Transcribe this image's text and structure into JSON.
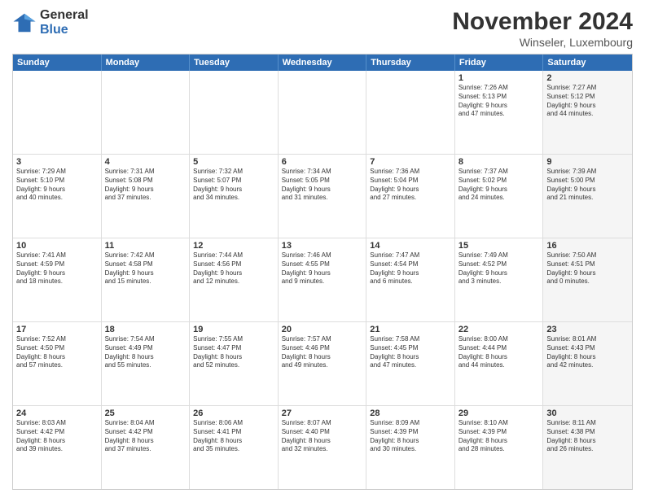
{
  "header": {
    "logo_line1": "General",
    "logo_line2": "Blue",
    "month": "November 2024",
    "location": "Winseler, Luxembourg"
  },
  "days_of_week": [
    "Sunday",
    "Monday",
    "Tuesday",
    "Wednesday",
    "Thursday",
    "Friday",
    "Saturday"
  ],
  "rows": [
    [
      {
        "day": "",
        "info": "",
        "shaded": false
      },
      {
        "day": "",
        "info": "",
        "shaded": false
      },
      {
        "day": "",
        "info": "",
        "shaded": false
      },
      {
        "day": "",
        "info": "",
        "shaded": false
      },
      {
        "day": "",
        "info": "",
        "shaded": false
      },
      {
        "day": "1",
        "info": "Sunrise: 7:26 AM\nSunset: 5:13 PM\nDaylight: 9 hours\nand 47 minutes.",
        "shaded": false
      },
      {
        "day": "2",
        "info": "Sunrise: 7:27 AM\nSunset: 5:12 PM\nDaylight: 9 hours\nand 44 minutes.",
        "shaded": true
      }
    ],
    [
      {
        "day": "3",
        "info": "Sunrise: 7:29 AM\nSunset: 5:10 PM\nDaylight: 9 hours\nand 40 minutes.",
        "shaded": false
      },
      {
        "day": "4",
        "info": "Sunrise: 7:31 AM\nSunset: 5:08 PM\nDaylight: 9 hours\nand 37 minutes.",
        "shaded": false
      },
      {
        "day": "5",
        "info": "Sunrise: 7:32 AM\nSunset: 5:07 PM\nDaylight: 9 hours\nand 34 minutes.",
        "shaded": false
      },
      {
        "day": "6",
        "info": "Sunrise: 7:34 AM\nSunset: 5:05 PM\nDaylight: 9 hours\nand 31 minutes.",
        "shaded": false
      },
      {
        "day": "7",
        "info": "Sunrise: 7:36 AM\nSunset: 5:04 PM\nDaylight: 9 hours\nand 27 minutes.",
        "shaded": false
      },
      {
        "day": "8",
        "info": "Sunrise: 7:37 AM\nSunset: 5:02 PM\nDaylight: 9 hours\nand 24 minutes.",
        "shaded": false
      },
      {
        "day": "9",
        "info": "Sunrise: 7:39 AM\nSunset: 5:00 PM\nDaylight: 9 hours\nand 21 minutes.",
        "shaded": true
      }
    ],
    [
      {
        "day": "10",
        "info": "Sunrise: 7:41 AM\nSunset: 4:59 PM\nDaylight: 9 hours\nand 18 minutes.",
        "shaded": false
      },
      {
        "day": "11",
        "info": "Sunrise: 7:42 AM\nSunset: 4:58 PM\nDaylight: 9 hours\nand 15 minutes.",
        "shaded": false
      },
      {
        "day": "12",
        "info": "Sunrise: 7:44 AM\nSunset: 4:56 PM\nDaylight: 9 hours\nand 12 minutes.",
        "shaded": false
      },
      {
        "day": "13",
        "info": "Sunrise: 7:46 AM\nSunset: 4:55 PM\nDaylight: 9 hours\nand 9 minutes.",
        "shaded": false
      },
      {
        "day": "14",
        "info": "Sunrise: 7:47 AM\nSunset: 4:54 PM\nDaylight: 9 hours\nand 6 minutes.",
        "shaded": false
      },
      {
        "day": "15",
        "info": "Sunrise: 7:49 AM\nSunset: 4:52 PM\nDaylight: 9 hours\nand 3 minutes.",
        "shaded": false
      },
      {
        "day": "16",
        "info": "Sunrise: 7:50 AM\nSunset: 4:51 PM\nDaylight: 9 hours\nand 0 minutes.",
        "shaded": true
      }
    ],
    [
      {
        "day": "17",
        "info": "Sunrise: 7:52 AM\nSunset: 4:50 PM\nDaylight: 8 hours\nand 57 minutes.",
        "shaded": false
      },
      {
        "day": "18",
        "info": "Sunrise: 7:54 AM\nSunset: 4:49 PM\nDaylight: 8 hours\nand 55 minutes.",
        "shaded": false
      },
      {
        "day": "19",
        "info": "Sunrise: 7:55 AM\nSunset: 4:47 PM\nDaylight: 8 hours\nand 52 minutes.",
        "shaded": false
      },
      {
        "day": "20",
        "info": "Sunrise: 7:57 AM\nSunset: 4:46 PM\nDaylight: 8 hours\nand 49 minutes.",
        "shaded": false
      },
      {
        "day": "21",
        "info": "Sunrise: 7:58 AM\nSunset: 4:45 PM\nDaylight: 8 hours\nand 47 minutes.",
        "shaded": false
      },
      {
        "day": "22",
        "info": "Sunrise: 8:00 AM\nSunset: 4:44 PM\nDaylight: 8 hours\nand 44 minutes.",
        "shaded": false
      },
      {
        "day": "23",
        "info": "Sunrise: 8:01 AM\nSunset: 4:43 PM\nDaylight: 8 hours\nand 42 minutes.",
        "shaded": true
      }
    ],
    [
      {
        "day": "24",
        "info": "Sunrise: 8:03 AM\nSunset: 4:42 PM\nDaylight: 8 hours\nand 39 minutes.",
        "shaded": false
      },
      {
        "day": "25",
        "info": "Sunrise: 8:04 AM\nSunset: 4:42 PM\nDaylight: 8 hours\nand 37 minutes.",
        "shaded": false
      },
      {
        "day": "26",
        "info": "Sunrise: 8:06 AM\nSunset: 4:41 PM\nDaylight: 8 hours\nand 35 minutes.",
        "shaded": false
      },
      {
        "day": "27",
        "info": "Sunrise: 8:07 AM\nSunset: 4:40 PM\nDaylight: 8 hours\nand 32 minutes.",
        "shaded": false
      },
      {
        "day": "28",
        "info": "Sunrise: 8:09 AM\nSunset: 4:39 PM\nDaylight: 8 hours\nand 30 minutes.",
        "shaded": false
      },
      {
        "day": "29",
        "info": "Sunrise: 8:10 AM\nSunset: 4:39 PM\nDaylight: 8 hours\nand 28 minutes.",
        "shaded": false
      },
      {
        "day": "30",
        "info": "Sunrise: 8:11 AM\nSunset: 4:38 PM\nDaylight: 8 hours\nand 26 minutes.",
        "shaded": true
      }
    ]
  ]
}
